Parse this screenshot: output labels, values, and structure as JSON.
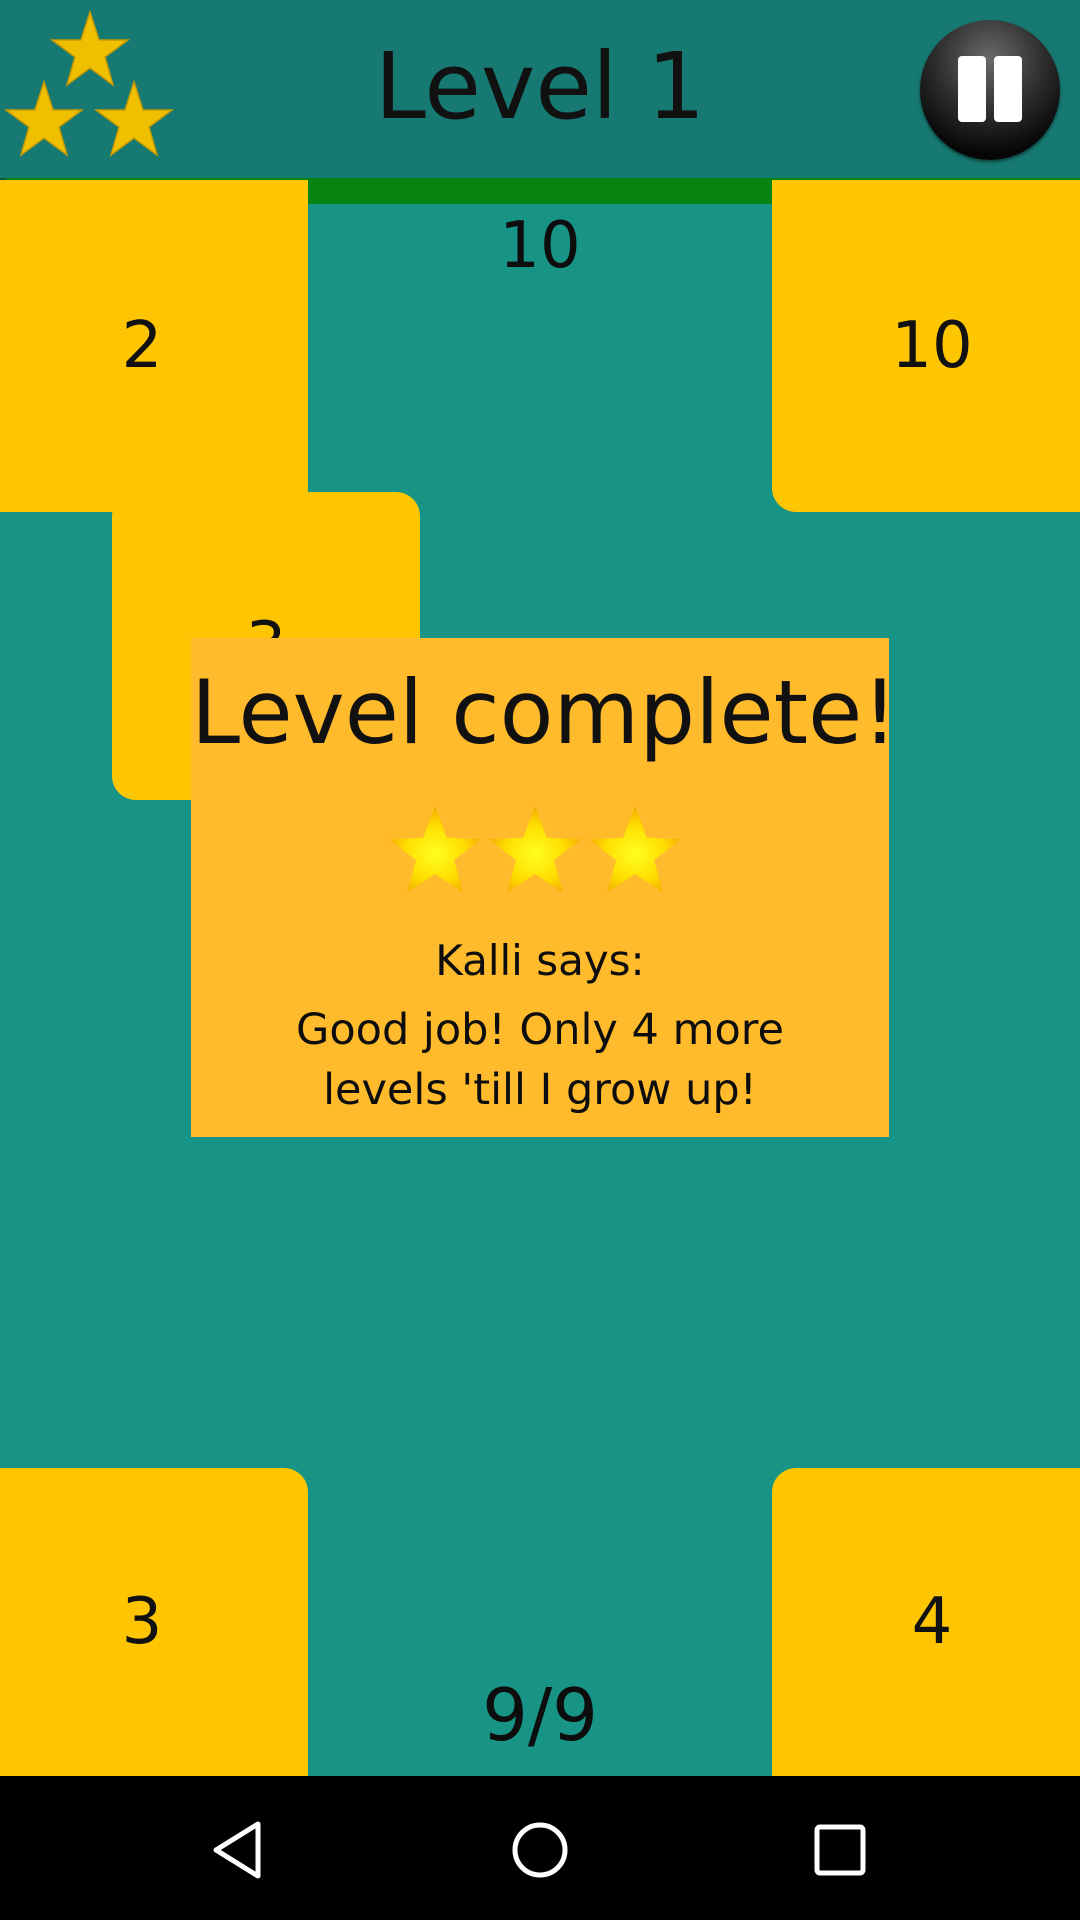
{
  "header": {
    "title": "Level 1",
    "stars_icon": "three-stars-icon",
    "pause_icon": "pause-icon",
    "progress": 1.0
  },
  "board": {
    "target": "10",
    "counter": "9/9",
    "tiles": {
      "top_left": "2",
      "top_right": "10",
      "mid_left": "3",
      "bottom_left": "3",
      "bottom_right": "4"
    }
  },
  "dialog": {
    "title": "Level complete!",
    "stars_earned": 3,
    "speaker": "Kalli says:",
    "message": "Good job! Only 4 more levels 'till I grow up!"
  },
  "nav": {
    "back_icon": "back-triangle-icon",
    "home_icon": "home-circle-icon",
    "recents_icon": "recents-square-icon"
  },
  "colors": {
    "background": "#179486",
    "header": "#177a72",
    "tile": "#fec502",
    "dialog": "#ffbb2c",
    "progress": "#078310",
    "star": "#f5c400"
  }
}
